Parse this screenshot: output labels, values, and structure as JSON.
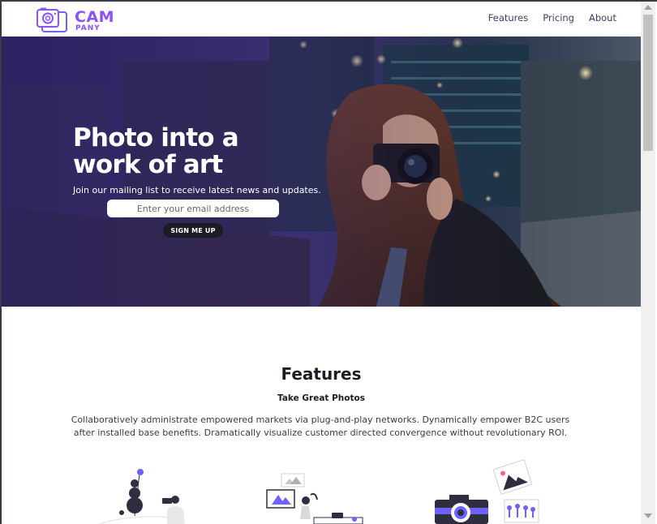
{
  "brand": {
    "name_top": "CAM",
    "name_bottom": "PANY",
    "accent_color": "#8c52ff",
    "icon": "camera-logo-icon"
  },
  "nav": {
    "links": [
      "Features",
      "Pricing",
      "About"
    ]
  },
  "hero": {
    "title": "Photo into a work of art",
    "subtitle": "Join our mailing list to receive latest news and updates.",
    "email_placeholder": "Enter your email address",
    "signup_label": "SIGN ME UP",
    "background": "photo of a woman holding a camera on a city bridge at night"
  },
  "features": {
    "heading": "Features",
    "subheading": "Take Great Photos",
    "body": "Collaboratively administrate empowered markets via plug-and-play networks. Dynamically empower B2C users after installed base benefits. Dramatically visualize customer directed convergence without revolutionary ROI.",
    "illustrations": [
      "person-photographing-illustration",
      "person-gallery-illustration",
      "camera-photos-illustration"
    ],
    "illustration_accent": "#6c63ff"
  }
}
